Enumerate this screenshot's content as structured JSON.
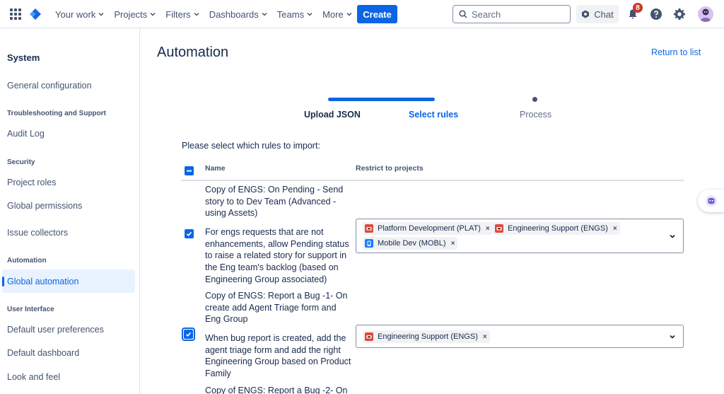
{
  "nav": {
    "items": [
      "Your work",
      "Projects",
      "Filters",
      "Dashboards",
      "Teams",
      "More"
    ],
    "create_label": "Create",
    "search_placeholder": "Search",
    "chat_label": "Chat",
    "notifications_count": "8",
    "icons": [
      "app-switcher-icon",
      "jira-logo-icon",
      "search-icon",
      "chat-icon",
      "bell-icon",
      "help-icon",
      "gear-icon"
    ]
  },
  "sidebar": {
    "title": "System",
    "general_configuration": "General configuration",
    "troubleshooting_heading": "Troubleshooting and Support",
    "audit_log": "Audit Log",
    "security_heading": "Security",
    "project_roles": "Project roles",
    "global_permissions": "Global permissions",
    "issue_collectors": "Issue collectors",
    "automation_heading": "Automation",
    "global_automation": "Global automation",
    "ui_heading": "User Interface",
    "default_user_preferences": "Default user preferences",
    "default_dashboard": "Default dashboard",
    "look_and_feel": "Look and feel"
  },
  "main": {
    "title": "Automation",
    "return_link": "Return to list",
    "steps": [
      "Upload JSON",
      "Select rules",
      "Process"
    ],
    "active_step": "Select rules",
    "instructions": "Please select which rules to import:",
    "col_name": "Name",
    "col_restrict": "Restrict to projects",
    "rules": [
      {
        "name": "Copy of ENGS: On Pending - Send story to to Dev Team (Advanced - using Assets)",
        "description": "For engs requests that are not enhancements, allow Pending status to raise a related story for support in the Eng team's backlog (based on Engineering Group associated)",
        "checked": true,
        "projects": [
          "Platform Development (PLAT)",
          "Engineering Support (ENGS)",
          "Mobile Dev (MOBL)"
        ]
      },
      {
        "name": "Copy of ENGS: Report a Bug -1- On create add Agent Triage form and Eng Group",
        "description": "When bug report is created, add the agent triage form and add the right Engineering Group based on Product Family",
        "checked": true,
        "projects": [
          "Engineering Support (ENGS)"
        ]
      },
      {
        "name": "Copy of ENGS: Report a Bug -2- On",
        "description": "",
        "checked": false,
        "projects": []
      }
    ]
  },
  "colors": {
    "accent": "#0c66e4",
    "plat_icon": "#e2483d",
    "engs_icon": "#e2483d",
    "mobl_icon": "#1d7afc"
  }
}
